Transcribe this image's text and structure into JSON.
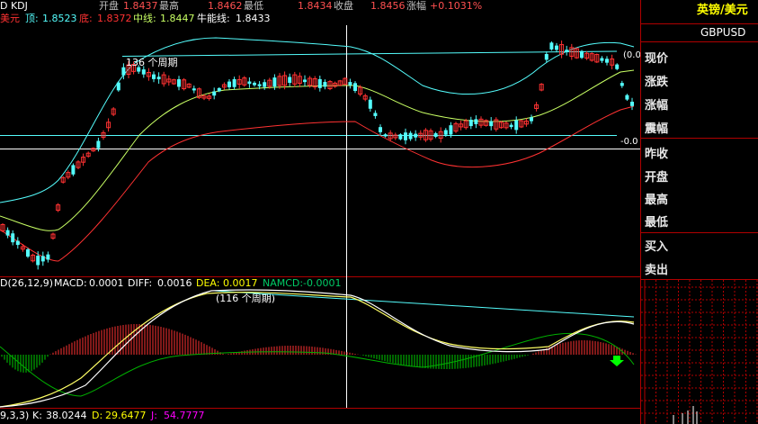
{
  "header": {
    "indicator_name": "D KDJ",
    "open_label": "开盘",
    "open_value": "1.8437",
    "high_label": "最高",
    "high_value": "1.8462",
    "low_label": "最低",
    "low_value": "1.8434",
    "close_label": "收盘",
    "close_value": "1.8456",
    "change_label": "涨幅",
    "change_value": "+0.1031%"
  },
  "boll": {
    "name": "美元",
    "top_label": "顶:",
    "top_value": "1.8523",
    "bottom_label": "底:",
    "bottom_value": "1.8372",
    "mid_label": "中线:",
    "mid_value": "1.8447",
    "bull_label": "牛能线:",
    "bull_value": "1.8433"
  },
  "main_chart": {
    "period_annotation": "136 个周期",
    "right_top_label": "(0.0",
    "right_bottom_label": "-0.0"
  },
  "macd": {
    "params": "D(26,12,9)",
    "macd_label": "MACD:",
    "macd_value": "0.0001",
    "diff_label": "DIFF:",
    "diff_value": "0.0016",
    "dea_label": "DEA:",
    "dea_value": "0.0017",
    "namcd_label": "NAMCD:",
    "namcd_value": "-0.0001",
    "period_annotation": "(116 个周期)"
  },
  "kdj": {
    "params": "9,3,3)",
    "k_label": "K:",
    "k_value": "38.0244",
    "d_label": "D:",
    "d_value": "29.6477",
    "j_label": "J:",
    "j_value": "54.7777"
  },
  "sidebar": {
    "title": "英镑/美元",
    "symbol": "GBPUSD",
    "labels": [
      "现价",
      "涨跌",
      "涨幅",
      "震幅",
      "昨收",
      "开盘",
      "最高",
      "最低",
      "买入",
      "卖出"
    ]
  },
  "colors": {
    "background": "#000000",
    "grid_red": "#b00000",
    "rise_red": "#ff3232",
    "fall_cyan": "#54fcfc",
    "yellow": "#ffff00",
    "white": "#ffffff",
    "green": "#00cc00",
    "magenta": "#ff00ff"
  }
}
